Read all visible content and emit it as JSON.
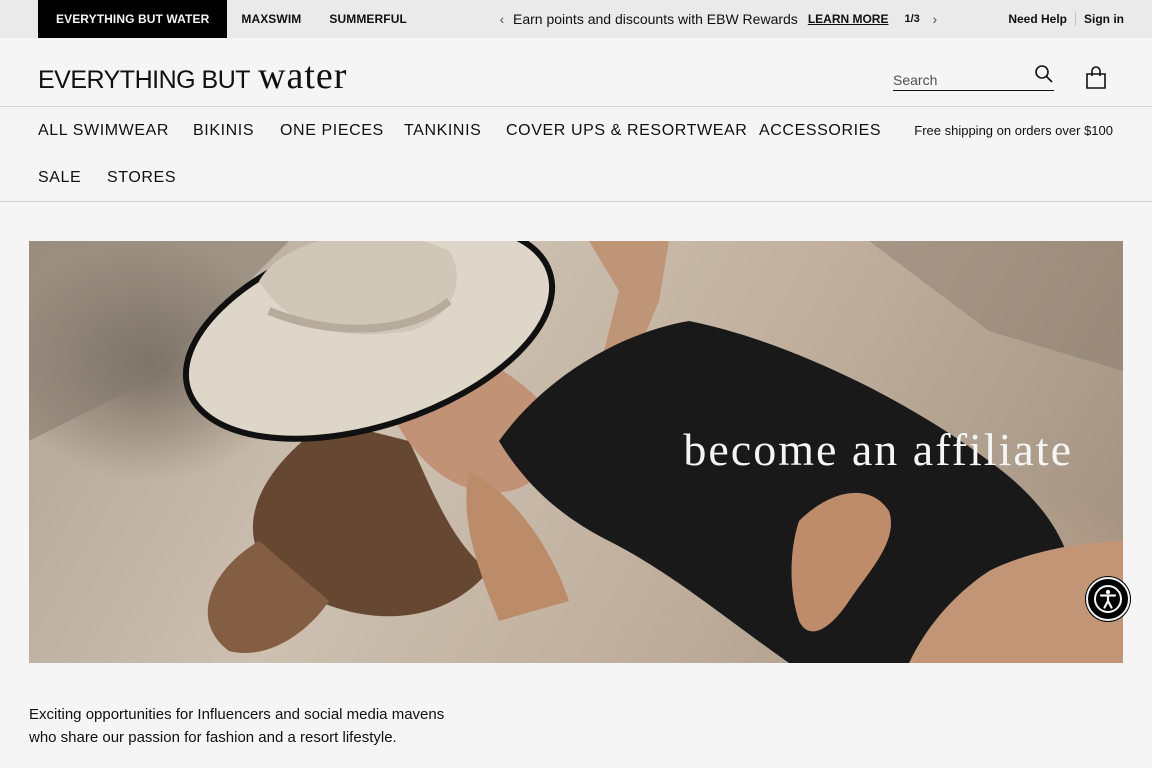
{
  "topbar": {
    "brands": [
      "EVERYTHING BUT WATER",
      "MAXSWIM",
      "SUMMERFUL"
    ],
    "promo": {
      "text": "Earn points and discounts with EBW Rewards",
      "link": "LEARN MORE",
      "counter": "1/3"
    },
    "utility": {
      "help": "Need Help",
      "signin": "Sign in"
    }
  },
  "header": {
    "logo": {
      "main": "EVERYTHING BUT",
      "script": "water"
    },
    "search": {
      "placeholder": "Search",
      "value": ""
    }
  },
  "nav": {
    "items": [
      "ALL SWIMWEAR",
      "BIKINIS",
      "ONE PIECES",
      "TANKINIS",
      "COVER UPS & RESORTWEAR",
      "ACCESSORIES",
      "SALE",
      "STORES"
    ],
    "shipping": "Free shipping on orders over $100"
  },
  "hero": {
    "title": "become an affiliate"
  },
  "intro": {
    "line1": "Exciting opportunities for Influencers and social media mavens",
    "line2": "who share our passion for fashion and a resort lifestyle."
  },
  "icons": {
    "search": "search-icon",
    "bag": "shopping-bag-icon",
    "accessibility": "accessibility-icon",
    "prev": "chevron-left-icon",
    "next": "chevron-right-icon"
  },
  "colors": {
    "black": "#000000",
    "topbar_bg": "#f4f4f4",
    "text": "#111111"
  }
}
